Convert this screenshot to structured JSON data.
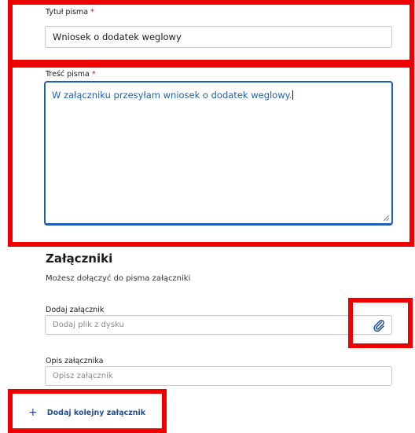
{
  "title_field": {
    "label": "Tytuł pisma",
    "required_mark": "*",
    "value": "Wniosek o dodatek weglowy"
  },
  "content_field": {
    "label": "Treść pisma",
    "required_mark": "*",
    "value": "W załączniku przesyłam wniosek o dodatek weglowy."
  },
  "attachments": {
    "heading": "Załączniki",
    "description": "Możesz dołączyć do pisma załączniki",
    "add_label": "Dodaj załącznik",
    "add_placeholder": "Dodaj plik z dysku",
    "attach_icon": "paperclip-icon",
    "desc_label": "Opis załącznika",
    "desc_placeholder": "Opisz załącznik",
    "add_another": "Dodaj kolejny załącznik",
    "add_another_icon": "plus-icon"
  },
  "colors": {
    "accent": "#1f5fb0",
    "link": "#1f4f99",
    "highlight": "#ee0000",
    "required": "#d0021b"
  }
}
